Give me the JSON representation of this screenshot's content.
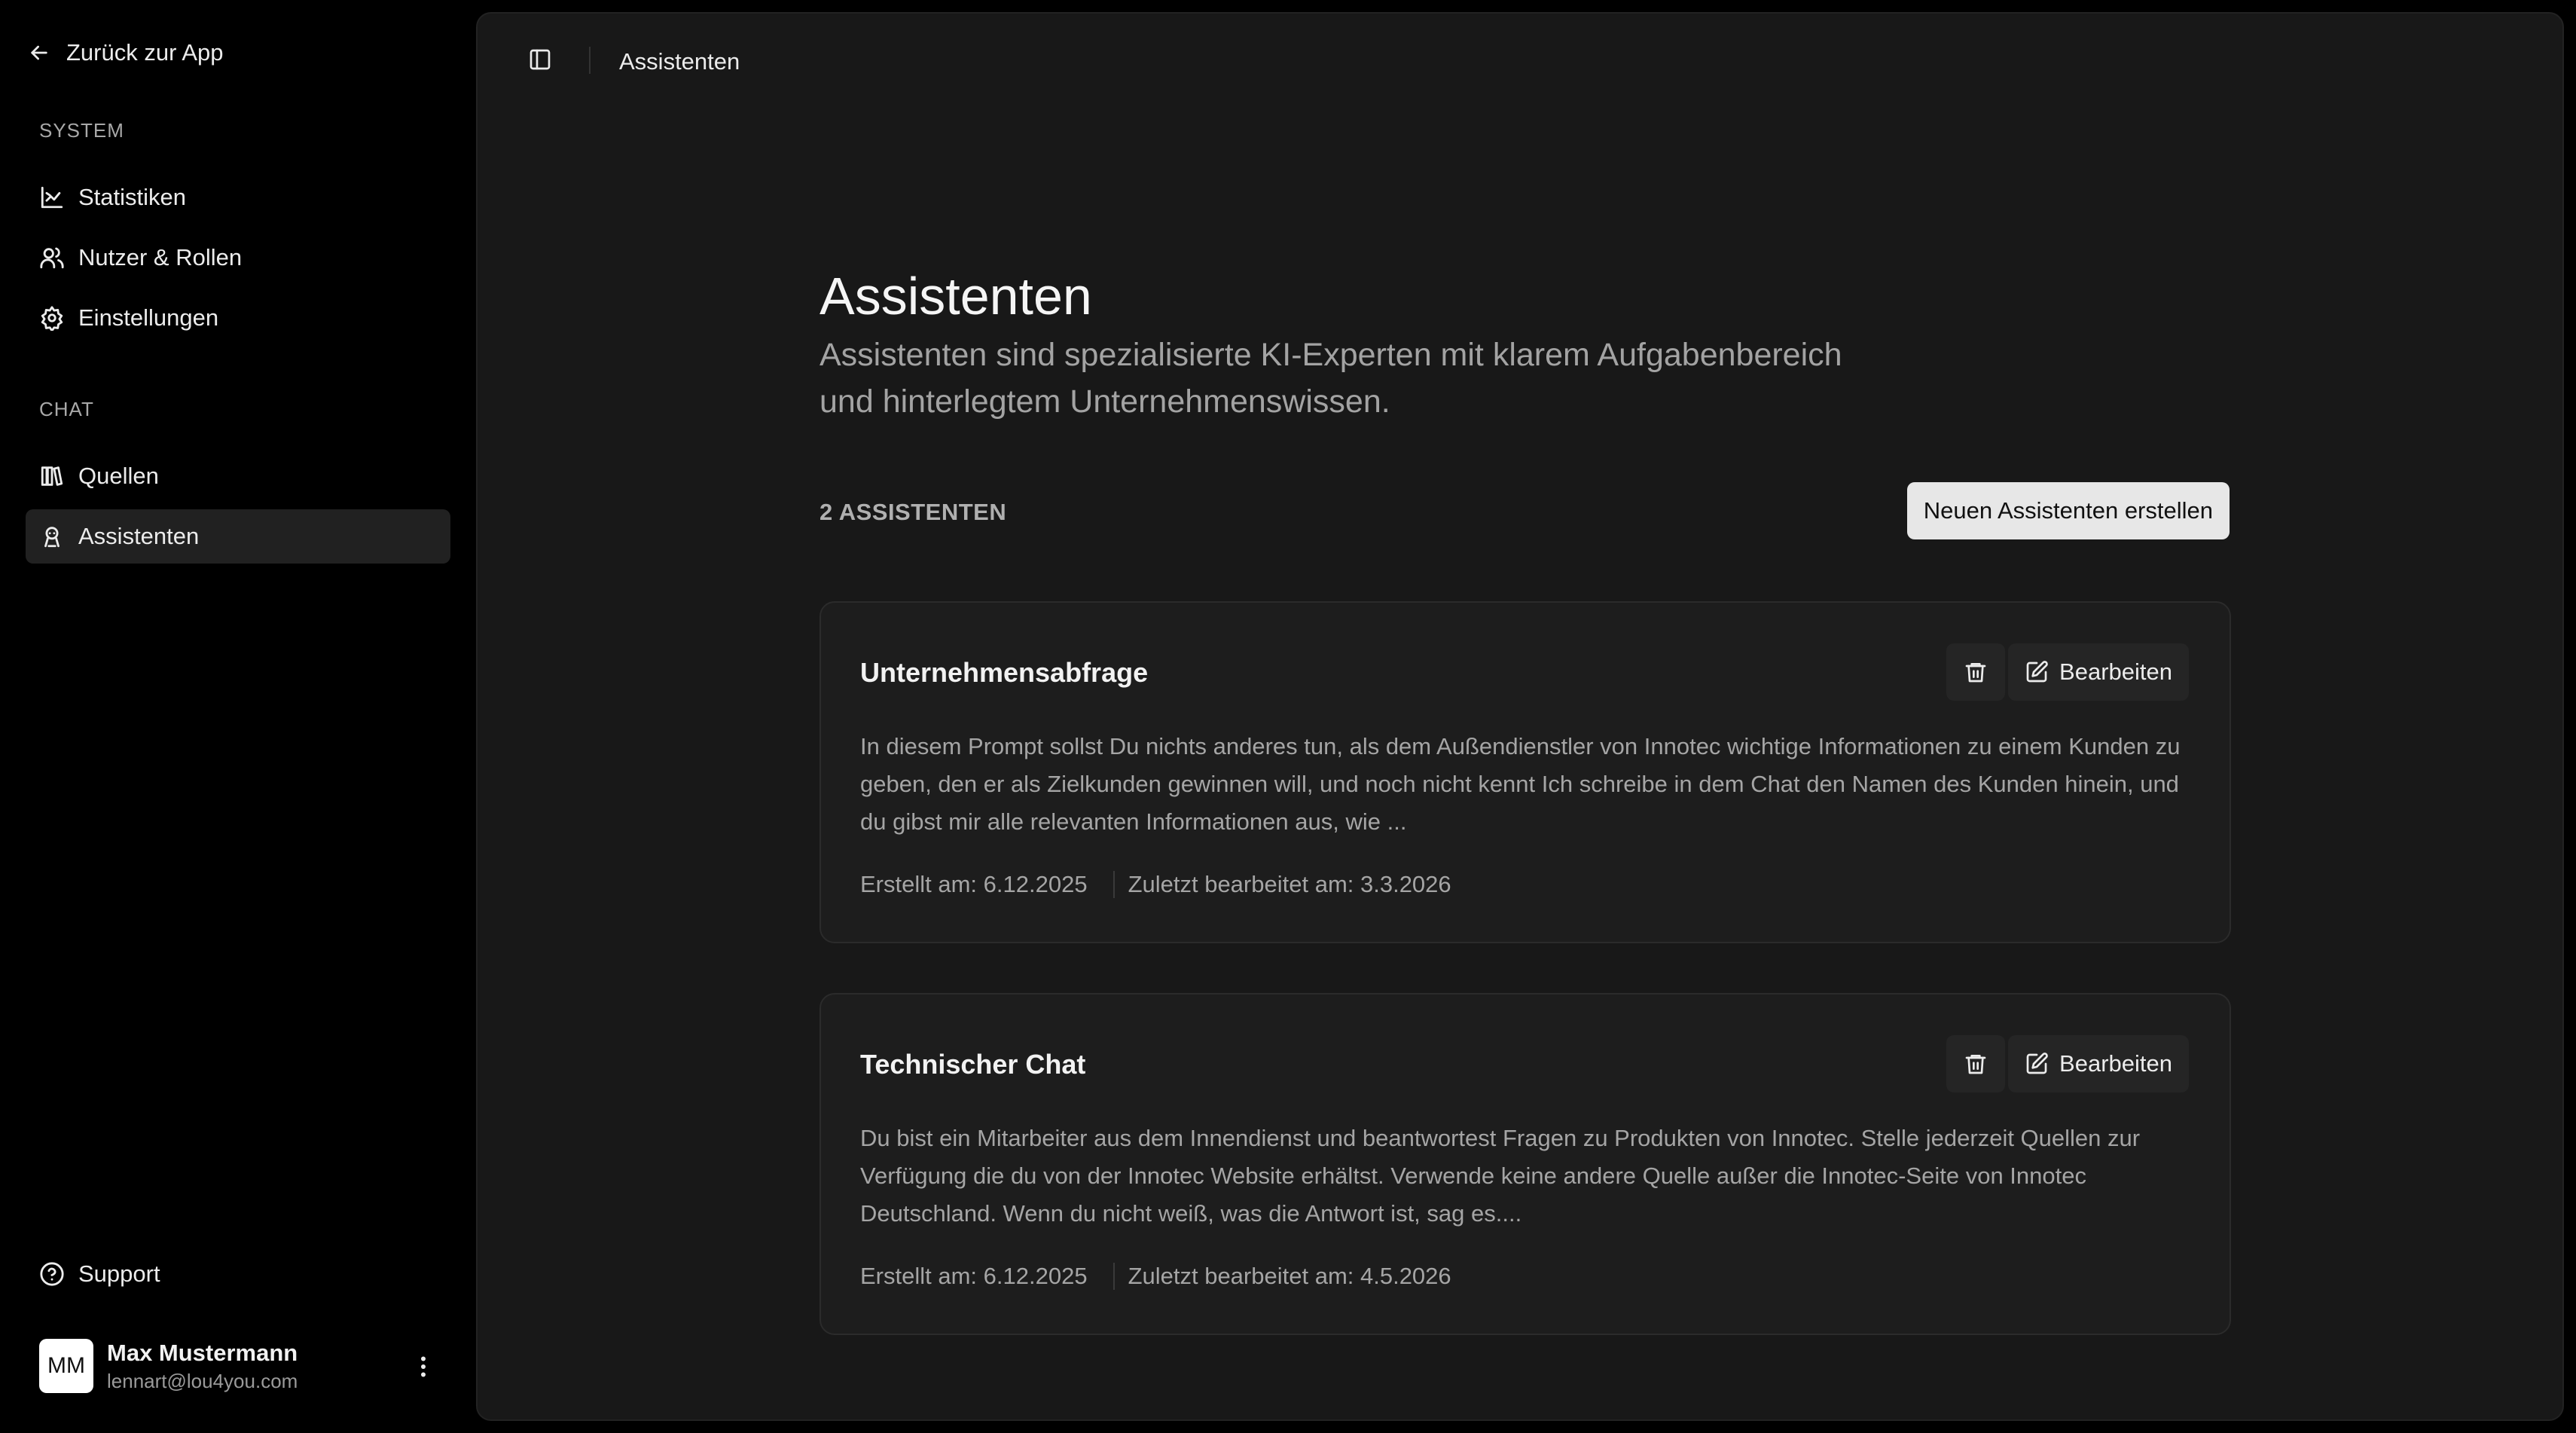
{
  "sidebar": {
    "back_label": "Zurück zur App",
    "sections": [
      {
        "label": "SYSTEM",
        "items": [
          {
            "label": "Statistiken",
            "icon": "chart-icon"
          },
          {
            "label": "Nutzer & Rollen",
            "icon": "users-icon"
          },
          {
            "label": "Einstellungen",
            "icon": "gear-icon"
          }
        ]
      },
      {
        "label": "CHAT",
        "items": [
          {
            "label": "Quellen",
            "icon": "library-icon"
          },
          {
            "label": "Assistenten",
            "icon": "bot-icon",
            "active": true
          }
        ]
      }
    ],
    "support_label": "Support",
    "user": {
      "initials": "MM",
      "name": "Max Mustermann",
      "email": "lennart@lou4you.com"
    }
  },
  "header": {
    "breadcrumb": "Assistenten"
  },
  "main": {
    "title": "Assistenten",
    "description": "Assistenten sind spezialisierte KI-Experten mit klarem Aufgabenbereich und hinterlegtem Unternehmenswissen.",
    "count_label": "2 ASSISTENTEN",
    "create_button": "Neuen Assistenten erstellen",
    "assistants": [
      {
        "name": "Unternehmensabfrage",
        "description": "In diesem Prompt sollst Du nichts anderes tun, als dem Außendienstler von Innotec wichtige Informationen zu einem Kunden zu geben, den er als Zielkunden gewinnen will, und noch nicht kennt Ich schreibe in dem Chat den Namen des Kunden hinein, und du gibst mir alle relevanten Informationen aus, wie ...",
        "created": "Erstellt am: 6.12.2025",
        "updated": "Zuletzt bearbeitet am: 3.3.2026",
        "edit_label": "Bearbeiten"
      },
      {
        "name": "Technischer Chat",
        "description": "Du bist ein Mitarbeiter aus dem Innendienst und beantwortest Fragen zu Produkten von Innotec. Stelle jederzeit Quellen zur Verfügung die du von der Innotec Website erhältst. Verwende keine andere Quelle außer die Innotec-Seite von Innotec Deutschland. Wenn du nicht weiß, was die Antwort ist, sag es....",
        "created": "Erstellt am: 6.12.2025",
        "updated": "Zuletzt bearbeitet am: 4.5.2026",
        "edit_label": "Bearbeiten"
      }
    ]
  },
  "colors": {
    "background": "#000000",
    "panel": "#181818",
    "card": "#1d1d1d",
    "active_nav": "#212121",
    "primary_button": "#e7e7e7",
    "muted_text": "#a5a5a5"
  }
}
